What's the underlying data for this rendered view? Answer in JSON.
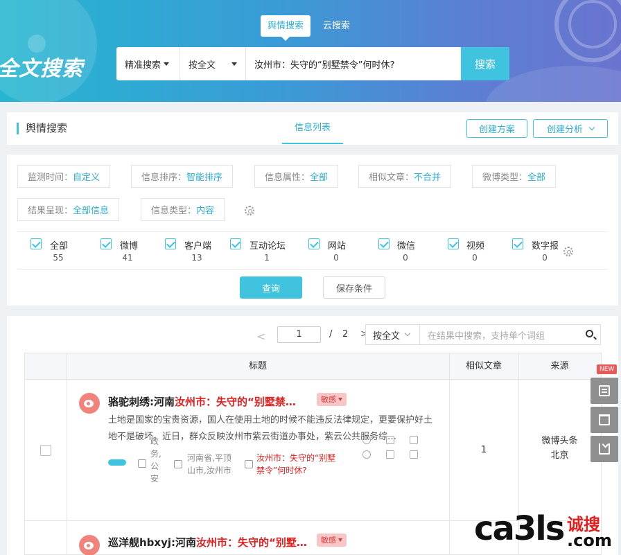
{
  "hero": {
    "logo": "全文搜索",
    "tabs": [
      "舆情搜索",
      "云搜索"
    ],
    "search": {
      "mode": "精准搜索",
      "scope": "按全文",
      "query": "汝州市：失守的“别墅禁令”何时休?",
      "button": "搜索"
    }
  },
  "header": {
    "title": "舆情搜索",
    "tab": "信息列表",
    "create_plan": "创建方案",
    "create_analysis": "创建分析"
  },
  "filters": [
    {
      "label": "监测时间：",
      "value": "自定义"
    },
    {
      "label": "信息排序：",
      "value": "智能排序"
    },
    {
      "label": "信息属性：",
      "value": "全部"
    },
    {
      "label": "相似文章：",
      "value": "不合并"
    },
    {
      "label": "微博类型：",
      "value": "全部"
    },
    {
      "label": "结果呈现：",
      "value": "全部信息"
    },
    {
      "label": "信息类型：",
      "value": "内容"
    }
  ],
  "sources": [
    {
      "label": "全部",
      "count": "55"
    },
    {
      "label": "微博",
      "count": "41"
    },
    {
      "label": "客户端",
      "count": "13"
    },
    {
      "label": "互动论坛",
      "count": "1"
    },
    {
      "label": "网站",
      "count": "0"
    },
    {
      "label": "微信",
      "count": "0"
    },
    {
      "label": "视频",
      "count": "0"
    },
    {
      "label": "数字报",
      "count": "0"
    }
  ],
  "actions": {
    "query": "查询",
    "save": "保存条件"
  },
  "results": {
    "pager": {
      "prev": "<",
      "current": "1",
      "sep": "/",
      "total": "2",
      "next": ">"
    },
    "scope": "按全文",
    "search_placeholder": "在结果中搜索，支持单个词组",
    "columns": {
      "title": "标题",
      "similar": "相似文章",
      "source": "来源"
    },
    "rows": [
      {
        "title_pre": "骆驼刺绣:河南",
        "title_hl": "汝州市：失守的“别墅禁…",
        "badge": "敏感",
        "summary": "土地是国家的宝贵资源，国人在使用土地的时候不能违反法律规定，更要保护好土地不是破坏。近日，群众反映汝州市紫云街道办事处，紫云公共服务综…",
        "category": "政务,公安",
        "region": "河南省,平顶山市,汝州市",
        "keyword": "汝州市：失守的“别墅禁令”何时休?",
        "similar": "1",
        "source": "微博头条",
        "location": "北京"
      },
      {
        "title_pre": "巡洋舰hbxyj:河南",
        "title_hl": "汝州市：失守的“别墅…",
        "badge": "敏感"
      }
    ]
  },
  "side_tools": {
    "new_tag": "NEW",
    "icons": [
      "document-icon",
      "trash-icon",
      "download-icon"
    ]
  },
  "watermark": {
    "latin": "ca3ls",
    "cn": "诚搜",
    "com": ".com"
  },
  "colors": {
    "accent": "#40c3de",
    "highlight": "#e02020",
    "badge_bg": "#f8c6c6"
  }
}
